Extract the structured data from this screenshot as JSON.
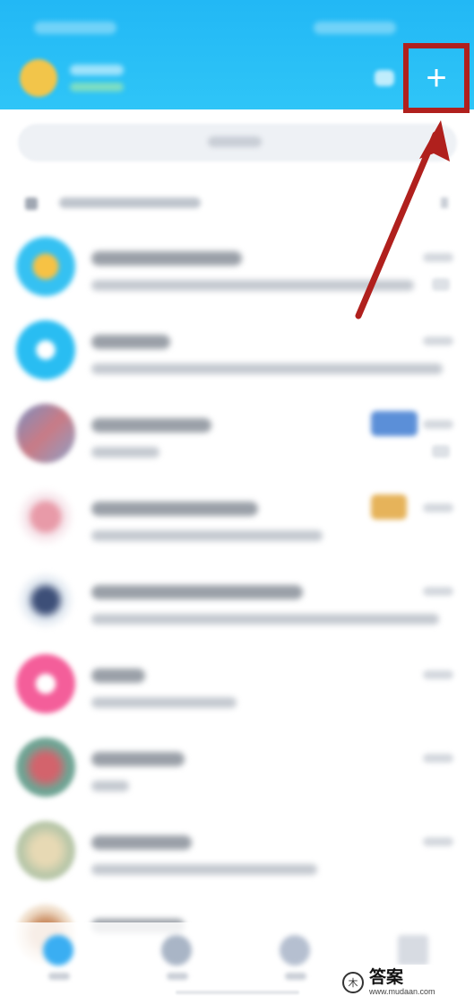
{
  "header": {
    "add_icon": "plus-icon",
    "add_glyph": "+",
    "contacts_icon": "contacts-icon",
    "highlight_color": "#b0201d",
    "background": "#22b8f5"
  },
  "annotation": {
    "arrow_color": "#b0201d",
    "description_target": "add-button"
  },
  "chat_list": {
    "item_count_visible": 9
  },
  "watermark": {
    "logo_glyph": "木",
    "text": "答案",
    "url": "www.mudaan.com"
  }
}
